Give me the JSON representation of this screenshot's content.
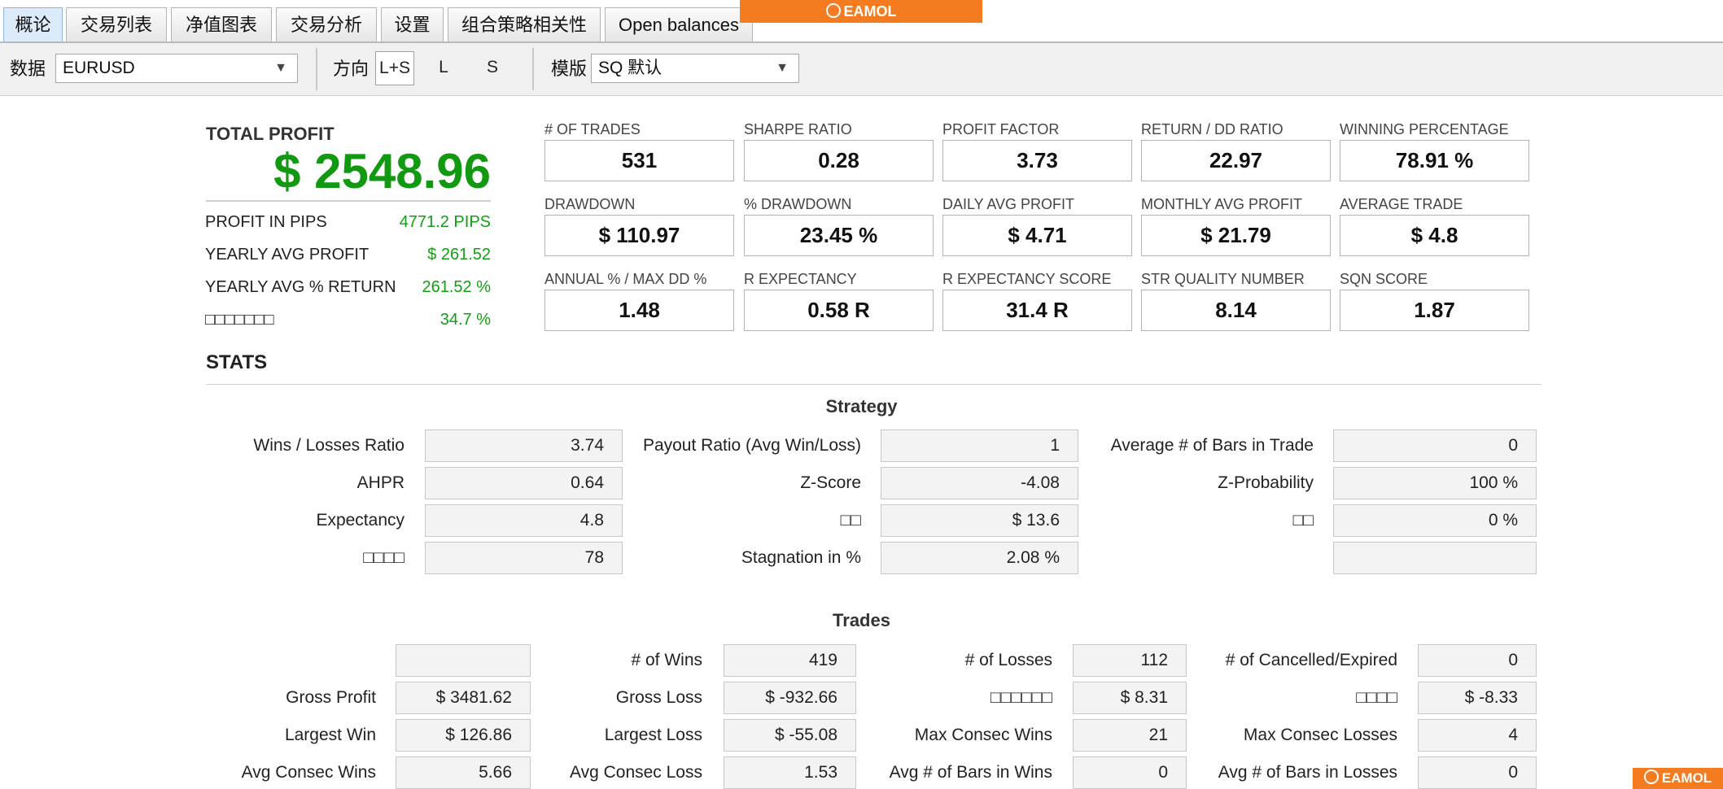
{
  "tabs": [
    {
      "label": "概论",
      "active": true
    },
    {
      "label": "交易列表"
    },
    {
      "label": "净值图表"
    },
    {
      "label": "交易分析"
    },
    {
      "label": "设置"
    },
    {
      "label": "组合策略相关性"
    },
    {
      "label": "Open balances"
    }
  ],
  "brand": {
    "logo": "EAMOL",
    "logo_color": "#f47b20"
  },
  "toolbar": {
    "data_label": "数据",
    "data_value": "EURUSD",
    "direction_label": "方向",
    "directions": [
      "L+S",
      "L",
      "S"
    ],
    "template_label": "模版",
    "template_value": "SQ 默认"
  },
  "summary": {
    "total_profit_label": "TOTAL PROFIT",
    "total_profit_value": "$ 2548.96",
    "rows": [
      {
        "label": "PROFIT IN PIPS",
        "value": "4771.2 PIPS"
      },
      {
        "label": "YEARLY AVG PROFIT",
        "value": "$ 261.52"
      },
      {
        "label": "YEARLY AVG % RETURN",
        "value": "261.52 %"
      },
      {
        "label": "□□□□□□□",
        "value": "34.7 %"
      }
    ],
    "profit_color": "#119a11"
  },
  "cards": [
    [
      {
        "label": "# OF TRADES",
        "value": "531"
      },
      {
        "label": "SHARPE RATIO",
        "value": "0.28"
      },
      {
        "label": "PROFIT FACTOR",
        "value": "3.73"
      },
      {
        "label": "RETURN / DD RATIO",
        "value": "22.97"
      },
      {
        "label": "WINNING PERCENTAGE",
        "value": "78.91 %"
      }
    ],
    [
      {
        "label": "DRAWDOWN",
        "value": "$ 110.97"
      },
      {
        "label": "% DRAWDOWN",
        "value": "23.45 %"
      },
      {
        "label": "DAILY AVG PROFIT",
        "value": "$ 4.71"
      },
      {
        "label": "MONTHLY AVG PROFIT",
        "value": "$ 21.79"
      },
      {
        "label": "AVERAGE TRADE",
        "value": "$ 4.8"
      }
    ],
    [
      {
        "label": "ANNUAL % / MAX DD %",
        "value": "1.48"
      },
      {
        "label": "R EXPECTANCY",
        "value": "0.58 R"
      },
      {
        "label": "R EXPECTANCY SCORE",
        "value": "31.4 R"
      },
      {
        "label": "STR QUALITY NUMBER",
        "value": "8.14"
      },
      {
        "label": "SQN SCORE",
        "value": "1.87"
      }
    ]
  ],
  "stats": {
    "title": "STATS",
    "strategy": {
      "title": "Strategy",
      "rows": [
        [
          {
            "label": "Wins / Losses Ratio",
            "value": "3.74"
          },
          {
            "label": "Payout Ratio (Avg Win/Loss)",
            "value": "1"
          },
          {
            "label": "Average # of Bars in Trade",
            "value": "0"
          }
        ],
        [
          {
            "label": "AHPR",
            "value": "0.64"
          },
          {
            "label": "Z-Score",
            "value": "-4.08"
          },
          {
            "label": "Z-Probability",
            "value": "100 %"
          }
        ],
        [
          {
            "label": "Expectancy",
            "value": "4.8"
          },
          {
            "label": "□□",
            "value": "$ 13.6"
          },
          {
            "label": "□□",
            "value": "0 %"
          }
        ],
        [
          {
            "label": "□□□□",
            "value": "78"
          },
          {
            "label": "Stagnation in %",
            "value": "2.08 %"
          },
          {
            "label": "",
            "value": ""
          }
        ]
      ]
    },
    "trades": {
      "title": "Trades",
      "rows": [
        [
          {
            "label": "",
            "value": ""
          },
          {
            "label": "# of Wins",
            "value": "419"
          },
          {
            "label": "# of Losses",
            "value": "112"
          },
          {
            "label": "# of Cancelled/Expired",
            "value": "0"
          }
        ],
        [
          {
            "label": "Gross Profit",
            "value": "$ 3481.62"
          },
          {
            "label": "Gross Loss",
            "value": "$ -932.66"
          },
          {
            "label": "□□□□□□",
            "value": "$ 8.31"
          },
          {
            "label": "□□□□",
            "value": "$ -8.33"
          }
        ],
        [
          {
            "label": "Largest Win",
            "value": "$ 126.86"
          },
          {
            "label": "Largest Loss",
            "value": "$ -55.08"
          },
          {
            "label": "Max Consec Wins",
            "value": "21"
          },
          {
            "label": "Max Consec Losses",
            "value": "4"
          }
        ],
        [
          {
            "label": "Avg Consec Wins",
            "value": "5.66"
          },
          {
            "label": "Avg Consec Loss",
            "value": "1.53"
          },
          {
            "label": "Avg # of Bars in Wins",
            "value": "0"
          },
          {
            "label": "Avg # of Bars in Losses",
            "value": "0"
          }
        ]
      ]
    }
  }
}
